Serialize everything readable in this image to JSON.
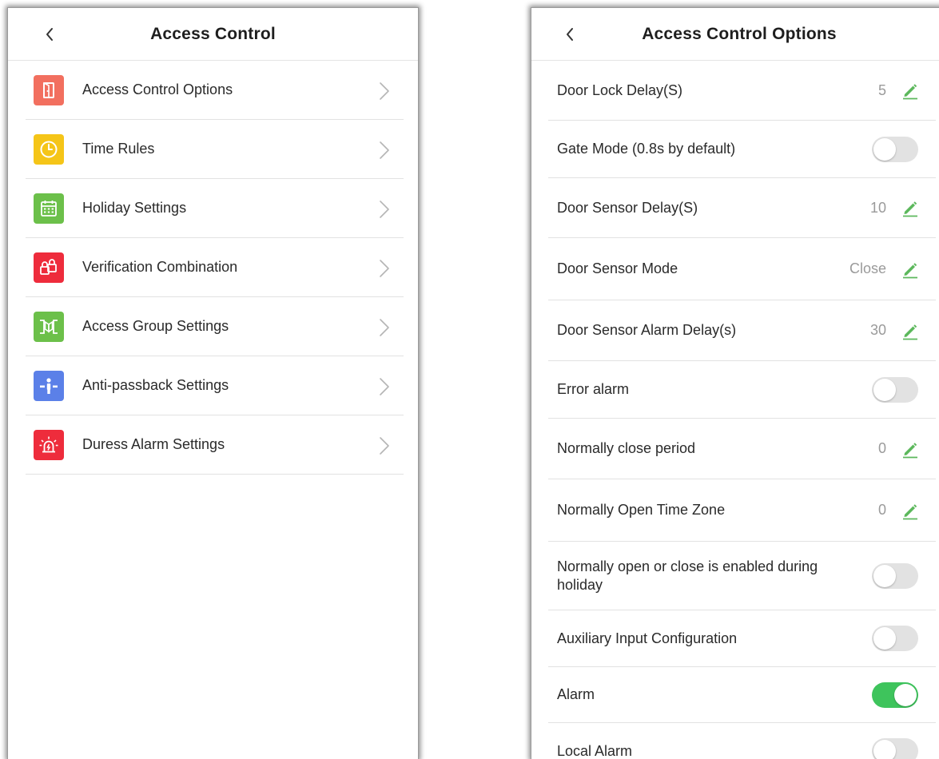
{
  "left_screen": {
    "title": "Access Control",
    "items": [
      {
        "label": "Access Control Options",
        "icon": "door-exit-icon",
        "color": "#f26f5f"
      },
      {
        "label": "Time Rules",
        "icon": "clock-icon",
        "color": "#f5c518"
      },
      {
        "label": "Holiday Settings",
        "icon": "calendar-icon",
        "color": "#6cc04a"
      },
      {
        "label": "Verification Combination",
        "icon": "lock-combination-icon",
        "color": "#ee2c3c"
      },
      {
        "label": "Access Group Settings",
        "icon": "gate-group-icon",
        "color": "#6cc04a"
      },
      {
        "label": "Anti-passback Settings",
        "icon": "turnstile-person-icon",
        "color": "#5b80e8"
      },
      {
        "label": "Duress Alarm Settings",
        "icon": "siren-alarm-icon",
        "color": "#ee2c3c"
      }
    ]
  },
  "right_screen": {
    "title": "Access Control Options",
    "options": [
      {
        "label": "Door Lock Delay(S)",
        "type": "edit",
        "value": "5"
      },
      {
        "label": "Gate Mode (0.8s by default)",
        "type": "toggle",
        "on": false
      },
      {
        "label": "Door Sensor Delay(S)",
        "type": "edit",
        "value": "10"
      },
      {
        "label": "Door Sensor Mode",
        "type": "edit",
        "value": "Close"
      },
      {
        "label": "Door Sensor Alarm Delay(s)",
        "type": "edit",
        "value": "30"
      },
      {
        "label": "Error alarm",
        "type": "toggle",
        "on": false
      },
      {
        "label": "Normally close period",
        "type": "edit",
        "value": "0"
      },
      {
        "label": "Normally Open Time Zone",
        "type": "edit",
        "value": "0"
      },
      {
        "label": "Normally open or close is enabled during holiday",
        "type": "toggle",
        "on": false
      },
      {
        "label": "Auxiliary Input Configuration",
        "type": "toggle",
        "on": false
      },
      {
        "label": "Alarm",
        "type": "toggle",
        "on": true
      },
      {
        "label": "Local Alarm",
        "type": "toggle",
        "on": false
      }
    ]
  },
  "colors": {
    "accent_green": "#3ec45c",
    "edit_icon_green": "#5cb85c",
    "toggle_off": "#e2e2e2",
    "chevron": "#b5b5b5"
  }
}
